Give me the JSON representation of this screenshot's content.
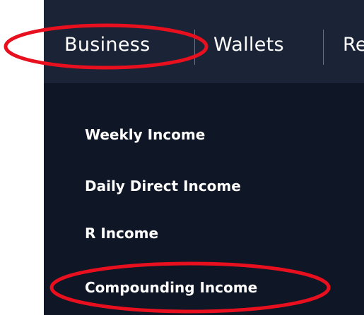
{
  "nav": {
    "tabs": [
      {
        "label": "Business"
      },
      {
        "label": "Wallets"
      },
      {
        "label": "Re"
      }
    ]
  },
  "business_menu": {
    "items": [
      {
        "label": "Weekly Income"
      },
      {
        "label": "Daily Direct Income"
      },
      {
        "label": "R Income"
      },
      {
        "label": "Compounding Income"
      }
    ]
  },
  "colors": {
    "nav_background": "#1b2436",
    "menu_background": "#0f1626",
    "text": "#ffffff",
    "annotation": "#e8101e"
  }
}
